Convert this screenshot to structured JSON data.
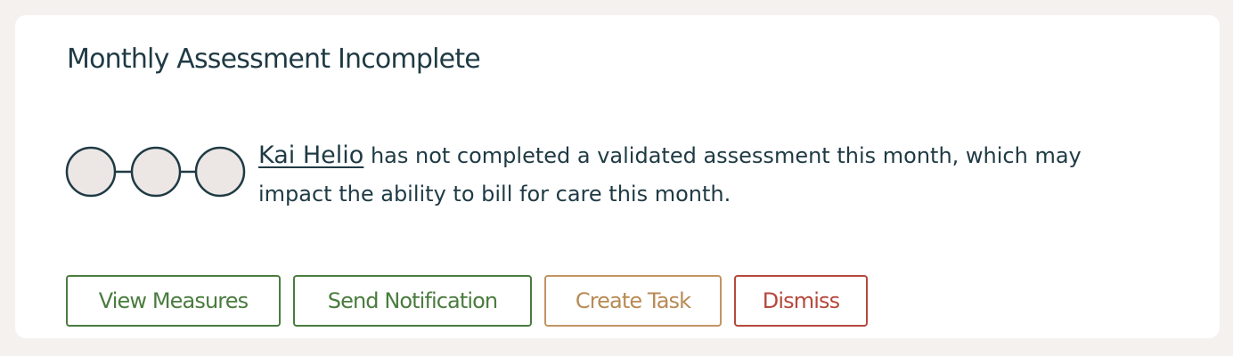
{
  "alert": {
    "title": "Monthly Assessment Incomplete",
    "patient_name": "Kai Helio",
    "message": "has not completed a validated assessment this month, which may impact the ability to bill for care this month.",
    "progress": {
      "completed_steps": 0,
      "total_steps": 3
    }
  },
  "actions": {
    "view_measures": "View Measures",
    "send_notification": "Send Notification",
    "create_task": "Create Task",
    "dismiss": "Dismiss"
  },
  "colors": {
    "background": "#f5f1ee",
    "card": "#ffffff",
    "text": "#1f3a44",
    "step_fill": "#ece7e5",
    "green": "#4a7c3f",
    "gold": "#c29462",
    "red": "#b5483c"
  }
}
